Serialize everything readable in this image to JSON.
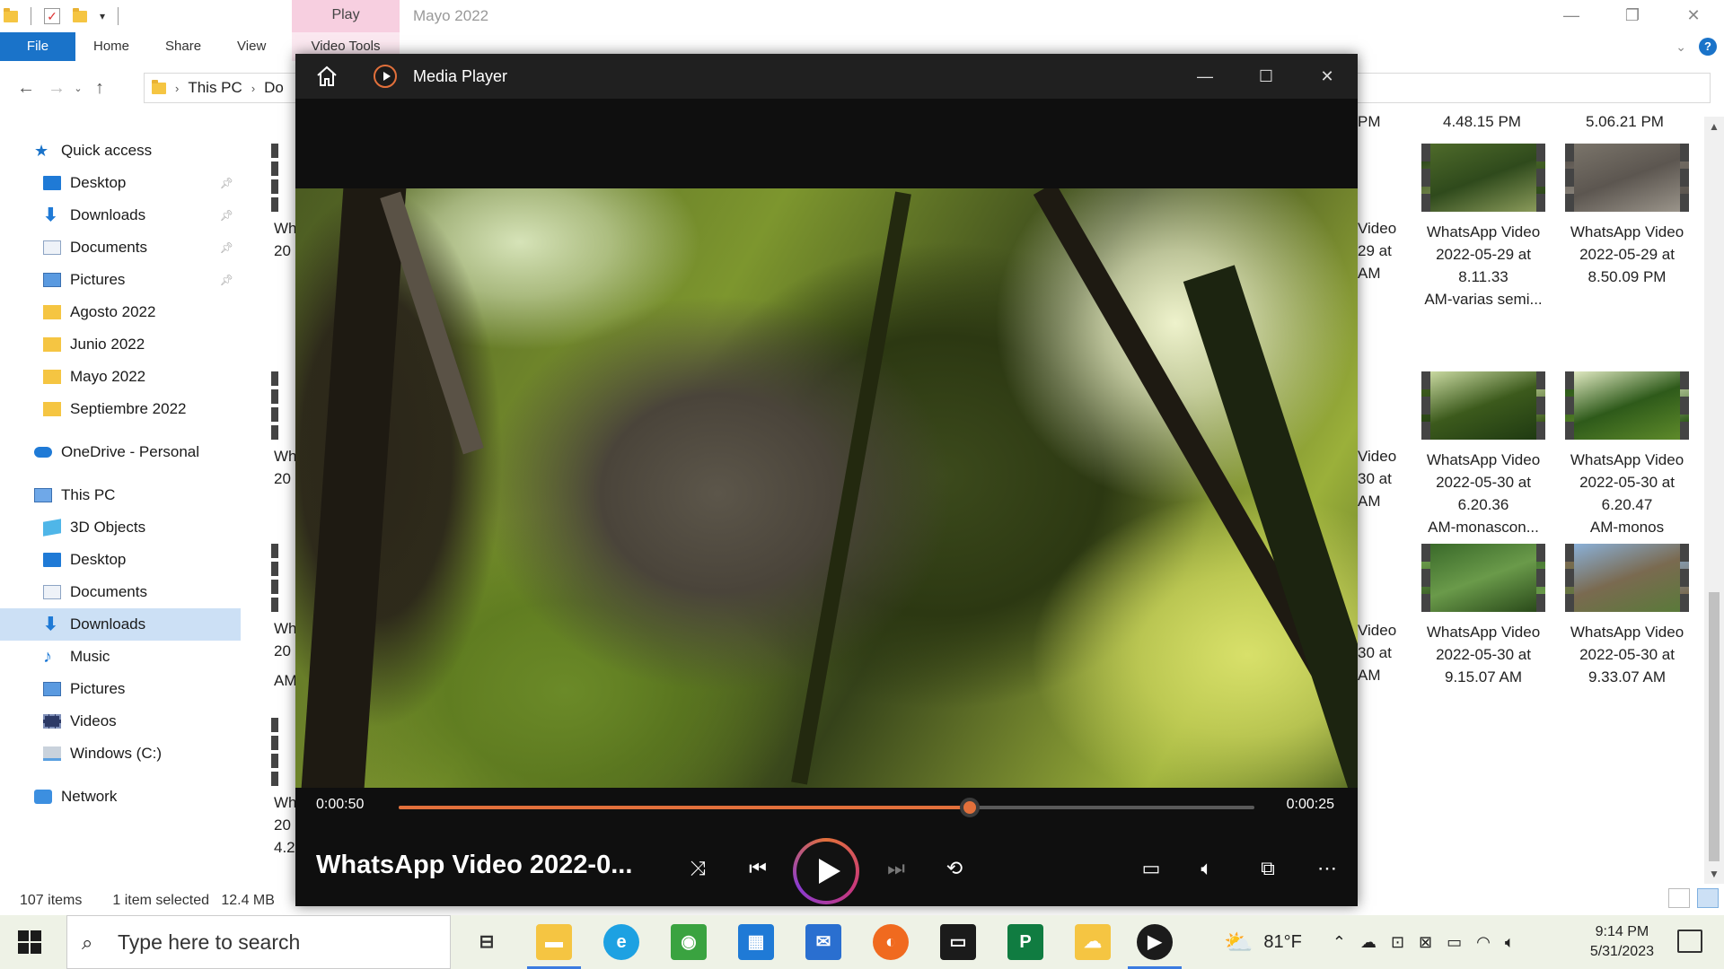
{
  "explorer": {
    "window_title": "Mayo 2022",
    "context_tab_play": "Play",
    "context_tab_tools": "Video Tools",
    "ribbon_tabs": [
      "File",
      "Home",
      "Share",
      "View"
    ],
    "breadcrumb": [
      "This PC",
      "Do"
    ],
    "sidebar": [
      {
        "label": "Quick access",
        "icon": "star-icon",
        "indent": 0
      },
      {
        "label": "Desktop",
        "icon": "desktop-icon",
        "indent": 1,
        "pinned": true
      },
      {
        "label": "Downloads",
        "icon": "download-icon",
        "indent": 1,
        "pinned": true
      },
      {
        "label": "Documents",
        "icon": "document-icon",
        "indent": 1,
        "pinned": true
      },
      {
        "label": "Pictures",
        "icon": "pictures-icon",
        "indent": 1,
        "pinned": true
      },
      {
        "label": "Agosto 2022",
        "icon": "folder-icon",
        "indent": 1
      },
      {
        "label": "Junio 2022",
        "icon": "folder-icon",
        "indent": 1
      },
      {
        "label": "Mayo 2022",
        "icon": "folder-icon",
        "indent": 1
      },
      {
        "label": "Septiembre 2022",
        "icon": "folder-icon",
        "indent": 1
      },
      {
        "label": "OneDrive - Personal",
        "icon": "cloud-icon",
        "indent": 0,
        "gap": true
      },
      {
        "label": "This PC",
        "icon": "computer-icon",
        "indent": 0,
        "gap": true
      },
      {
        "label": "3D Objects",
        "icon": "cube-icon",
        "indent": 1
      },
      {
        "label": "Desktop",
        "icon": "desktop-icon",
        "indent": 1
      },
      {
        "label": "Documents",
        "icon": "document-icon",
        "indent": 1
      },
      {
        "label": "Downloads",
        "icon": "download-icon",
        "indent": 1,
        "selected": true
      },
      {
        "label": "Music",
        "icon": "music-icon",
        "indent": 1
      },
      {
        "label": "Pictures",
        "icon": "pictures-icon",
        "indent": 1
      },
      {
        "label": "Videos",
        "icon": "video-folder-icon",
        "indent": 1
      },
      {
        "label": "Windows (C:)",
        "icon": "drive-icon",
        "indent": 1
      },
      {
        "label": "Network",
        "icon": "network-icon",
        "indent": 0,
        "gap": true
      }
    ],
    "top_partial_captions": [
      "PM",
      "4.48.15 PM",
      "5.06.21 PM"
    ],
    "files": [
      {
        "name": "WhatsApp Video 2022-05-29 at 8.11.33 AM-varias semi...",
        "lines": [
          "WhatsApp Video",
          "2022-05-29 at",
          "8.11.33",
          "AM-varias semi..."
        ]
      },
      {
        "name": "WhatsApp Video 2022-05-29 at 8.50.09 PM",
        "lines": [
          "WhatsApp Video",
          "2022-05-29 at",
          "8.50.09 PM"
        ]
      },
      {
        "name": "WhatsApp Video 2022-05-30 at 6.20.36 AM-monascon...",
        "lines": [
          "WhatsApp Video",
          "2022-05-30 at",
          "6.20.36",
          "AM-monascon..."
        ]
      },
      {
        "name": "WhatsApp Video 2022-05-30 at 6.20.47 AM-monos",
        "lines": [
          "WhatsApp Video",
          "2022-05-30 at",
          "6.20.47",
          "AM-monos"
        ]
      },
      {
        "name": "WhatsApp Video 2022-05-30 at 9.15.07 AM",
        "lines": [
          "WhatsApp Video",
          "2022-05-30 at",
          "9.15.07 AM"
        ]
      },
      {
        "name": "WhatsApp Video 2022-05-30 at 9.33.07 AM",
        "lines": [
          "WhatsApp Video",
          "2022-05-30 at",
          "9.33.07 AM"
        ]
      }
    ],
    "partial_left_captions": [
      "Wh",
      "20",
      "Wh",
      "20",
      "Wh",
      "20",
      "AM",
      "Wh",
      "20",
      "4.2"
    ],
    "partial_right_captions": [
      [
        "Video",
        "29 at",
        "AM"
      ],
      [
        "Video",
        "30 at",
        "AM"
      ],
      [
        "Video",
        "30 at",
        "AM"
      ]
    ],
    "status": {
      "count": "107 items",
      "selected": "1 item selected",
      "size": "12.4 MB"
    }
  },
  "player": {
    "app_name": "Media Player",
    "elapsed": "0:00:50",
    "remaining": "0:00:25",
    "progress_fraction": 0.667,
    "title": "WhatsApp Video 2022-0...",
    "accent_color": "#e2703b"
  },
  "taskbar": {
    "search_placeholder": "Type here to search",
    "temperature": "81°F",
    "time": "9:14 PM",
    "date": "5/31/2023"
  }
}
